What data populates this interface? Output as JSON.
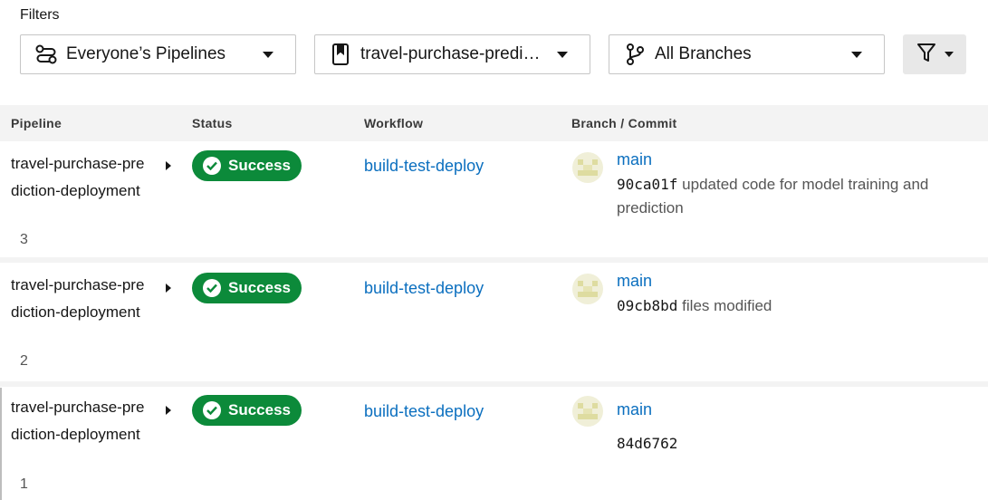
{
  "filters": {
    "label": "Filters",
    "pipelines": "Everyone’s Pipelines",
    "project": "travel-purchase-predic…",
    "branches": "All Branches"
  },
  "columns": {
    "pipeline": "Pipeline",
    "status": "Status",
    "workflow": "Workflow",
    "branch_commit": "Branch / Commit"
  },
  "rows": [
    {
      "pipeline": "travel-purchase-prediction-deployment",
      "number": "3",
      "status": "Success",
      "workflow": "build-test-deploy",
      "branch": "main",
      "commit_hash": "90ca01f",
      "commit_message": "updated code for model training and prediction"
    },
    {
      "pipeline": "travel-purchase-prediction-deployment",
      "number": "2",
      "status": "Success",
      "workflow": "build-test-deploy",
      "branch": "main",
      "commit_hash": "09cb8bd",
      "commit_message": "files modified"
    },
    {
      "pipeline": "travel-purchase-prediction-deployment",
      "number": "1",
      "status": "Success",
      "workflow": "build-test-deploy",
      "branch": "main",
      "commit_hash": "84d6762",
      "commit_message": ""
    }
  ],
  "colors": {
    "success": "#0c8a3a",
    "link": "#0b6fbf",
    "header_bg": "#f3f3f3"
  },
  "icons": {
    "pipelines_filter": "pipelines-icon",
    "project_filter": "bookmark-icon",
    "branch_filter": "git-branch-icon",
    "advanced_filter": "funnel-icon",
    "status": "check-circle-icon",
    "expand": "chevron-right-icon",
    "avatar": "user-avatar"
  }
}
